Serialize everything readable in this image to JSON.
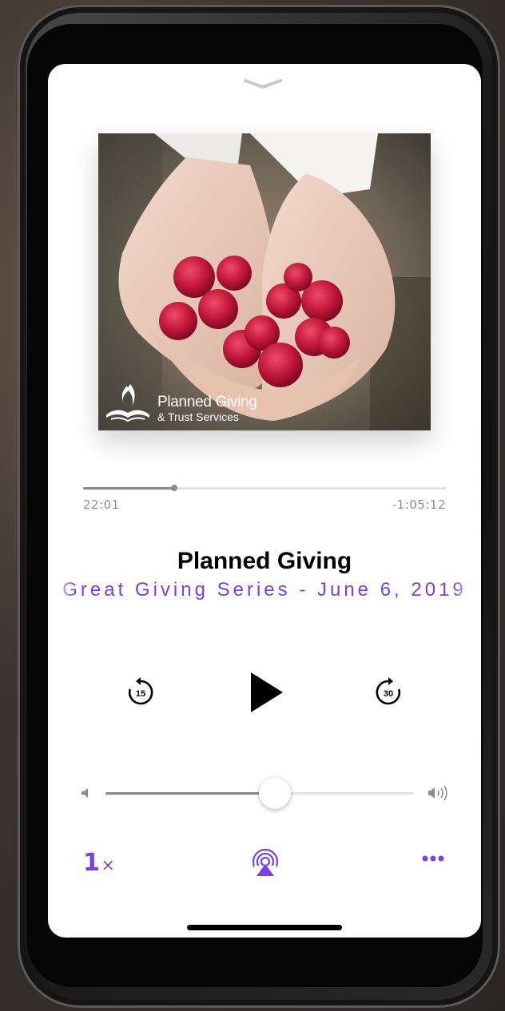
{
  "player": {
    "artwork": {
      "logo_title": "Planned Giving",
      "logo_subtitle": "& Trust Services"
    },
    "progress": {
      "elapsed": "22:01",
      "remaining": "-1:05:12",
      "fraction": 0.25
    },
    "track": {
      "title": "Planned Giving",
      "subtitle": "Great Giving Series - June 6, 2019"
    },
    "controls": {
      "skip_back_seconds": "15",
      "skip_forward_seconds": "30"
    },
    "volume": {
      "level": 0.55
    },
    "bottom": {
      "speed_value": "1",
      "speed_unit": "×"
    },
    "accent_color": "#7b3fe4",
    "icons": [
      "chevron-down-icon",
      "skip-back-15-icon",
      "play-icon",
      "skip-forward-30-icon",
      "volume-low-icon",
      "volume-high-icon",
      "airplay-icon",
      "more-icon"
    ]
  }
}
